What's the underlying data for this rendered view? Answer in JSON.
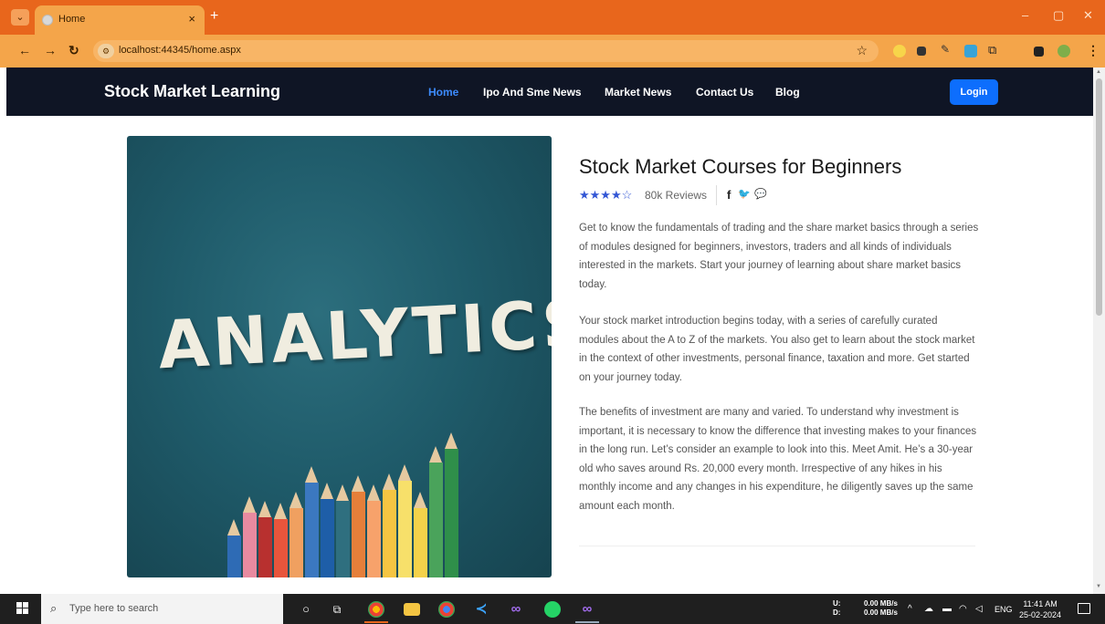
{
  "browser": {
    "tab_title": "Home",
    "tab_close": "×",
    "new_tab": "+",
    "url": "localhost:44345/home.aspx",
    "window_controls": [
      "–",
      "▢",
      "✕"
    ]
  },
  "site": {
    "brand": "Stock Market Learning",
    "nav": [
      {
        "label": "Home",
        "active": true
      },
      {
        "label": "Ipo And Sme News",
        "active": false
      },
      {
        "label": "Market News",
        "active": false
      },
      {
        "label": "Contact Us",
        "active": false
      },
      {
        "label": "Blog",
        "active": false
      }
    ],
    "login_label": "Login"
  },
  "hero": {
    "image_word": "ANALYTICS"
  },
  "course": {
    "title": "Stock Market Courses for Beginners",
    "rating_stars": "★★★★☆",
    "rating_value": 4,
    "reviews": "80k Reviews",
    "social": [
      "f",
      "🐦",
      "💬"
    ],
    "paragraphs": [
      "Get to know the fundamentals of trading and the share market basics through a series of modules designed for beginners, investors, traders and all kinds of individuals interested in the markets. Start your journey of learning about share market basics today.",
      "Your stock market introduction begins today, with a series of carefully curated modules about the A to Z of the markets. You also get to learn about the stock market in the context of other investments, personal finance, taxation and more. Get started on your journey today.",
      "The benefits of investment are many and varied. To understand why investment is important, it is necessary to know the difference that investing makes to your finances in the long run. Let’s consider an example to look into this. Meet Amit. He’s a 30-year old who saves around Rs. 20,000 every month. Irrespective of any hikes in his monthly income and any changes in his expenditure, he diligently saves up the same amount each month."
    ]
  },
  "taskbar": {
    "search_placeholder": "Type here to search",
    "net_up_label": "U:",
    "net_down_label": "D:",
    "net_up": "0.00 MB/s",
    "net_down": "0.00 MB/s",
    "language": "ENG",
    "time": "11:41 AM",
    "date": "25-02-2024"
  },
  "colors": {
    "browser_accent": "#e8661c",
    "navbar_bg": "#0f1525",
    "active_link": "#3d8bfd",
    "login_btn": "#0d6efd",
    "stars": "#3457d5"
  }
}
